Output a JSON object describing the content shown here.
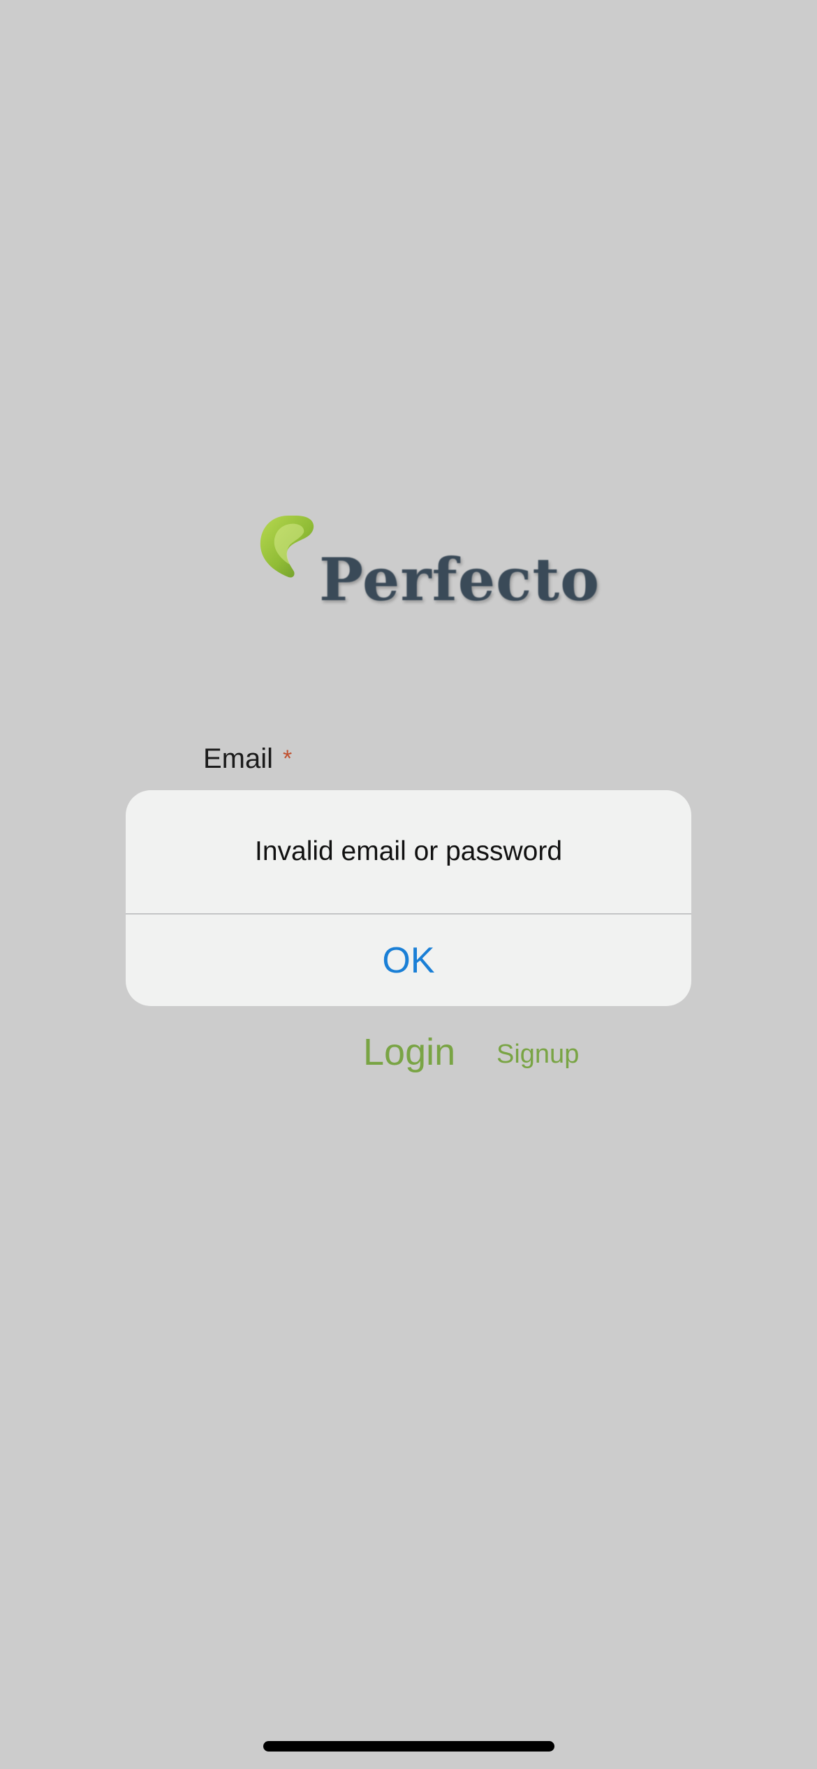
{
  "app": {
    "logo_text": "Perfecto",
    "logo_colors": {
      "leaf": "#8dbb2e",
      "leaf_dark": "#5e8f1e",
      "wordmark": "#3a4a58"
    }
  },
  "form": {
    "email_label": "Email",
    "required_mark": "*",
    "login_label": "Login",
    "signup_label": "Signup",
    "accent_color": "#79a444"
  },
  "alert": {
    "message": "Invalid email or password",
    "ok_label": "OK",
    "ok_color": "#1a7fd6"
  }
}
